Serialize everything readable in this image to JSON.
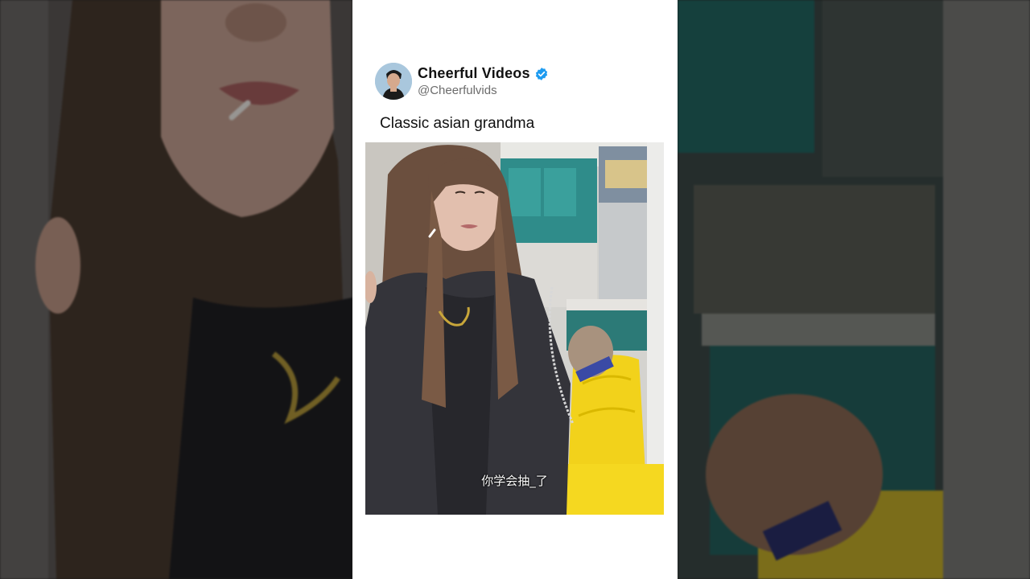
{
  "post": {
    "display_name": "Cheerful Videos",
    "handle": "@Cheerfulvids",
    "text": "Classic asian grandma",
    "verified": true
  },
  "video": {
    "subtitle": "你学会抽_了"
  },
  "colors": {
    "verified_badge": "#1d9bf0",
    "card_background": "#ffffff",
    "chair_yellow": "#f2d21b",
    "cabinet_teal": "#2f8c8a"
  },
  "icons": [
    "avatar",
    "verified-badge-icon"
  ]
}
